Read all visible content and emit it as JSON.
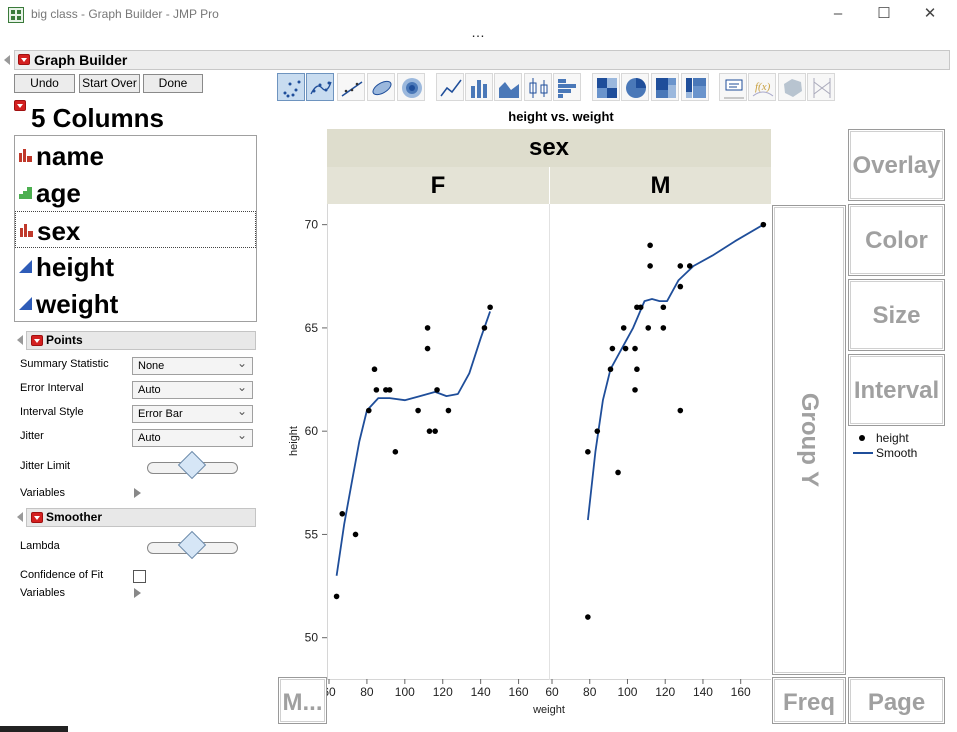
{
  "window": {
    "title": "big class - Graph Builder - JMP Pro",
    "min_glyph": "–",
    "max_glyph": "☐",
    "close_glyph": "✕",
    "overflow_glyph": "…"
  },
  "graph_builder": {
    "title": "Graph Builder",
    "buttons": {
      "undo": "Undo",
      "start_over": "Start Over",
      "done": "Done"
    }
  },
  "columns": {
    "count_label": "5 Columns",
    "items": [
      {
        "label": "name",
        "type": "nominal-character",
        "color": "#c0392b"
      },
      {
        "label": "age",
        "type": "ordinal",
        "color": "#4caf50"
      },
      {
        "label": "sex",
        "type": "nominal-character",
        "color": "#c0392b"
      },
      {
        "label": "height",
        "type": "continuous",
        "color": "#2e5cb8"
      },
      {
        "label": "weight",
        "type": "continuous",
        "color": "#2e5cb8"
      }
    ],
    "selected": "sex"
  },
  "points_panel": {
    "title": "Points",
    "summary_statistic": {
      "label": "Summary Statistic",
      "value": "None"
    },
    "error_interval": {
      "label": "Error Interval",
      "value": "Auto"
    },
    "interval_style": {
      "label": "Interval Style",
      "value": "Error Bar"
    },
    "jitter": {
      "label": "Jitter",
      "value": "Auto"
    },
    "jitter_limit": {
      "label": "Jitter Limit",
      "level": 0.5
    },
    "variables": {
      "label": "Variables"
    }
  },
  "smoother_panel": {
    "title": "Smoother",
    "lambda": {
      "label": "Lambda",
      "level": 0.5
    },
    "confidence_of_fit": {
      "label": "Confidence of Fit",
      "checked": false
    },
    "variables": {
      "label": "Variables"
    }
  },
  "toolbar": {
    "icons": [
      "points-icon",
      "jitter-points-icon",
      "line-of-fit-icon",
      "ellipse-icon",
      "contour-icon",
      "line-icon",
      "bar-icon",
      "area-icon",
      "box-plot-icon",
      "histogram-icon",
      "heatmap-icon",
      "pie-icon",
      "treemap-icon",
      "mosaic-icon",
      "caption-box-icon",
      "formula-icon",
      "map-shapes-icon",
      "parallel-axes-icon"
    ],
    "active": [
      "points-icon",
      "jitter-points-icon"
    ]
  },
  "drop_zones": {
    "overlay": "Overlay",
    "color": "Color",
    "size": "Size",
    "interval": "Interval",
    "group_y": "Group Y",
    "freq": "Freq",
    "page": "Page",
    "map": "M..."
  },
  "legend": {
    "points": "height",
    "line": "Smooth",
    "line_color": "#1f4e9a"
  },
  "chart_data": {
    "type": "scatter",
    "title": "height vs. weight",
    "group_title": "sex",
    "xlabel": "weight",
    "ylabel": "height",
    "xlim": [
      60,
      175
    ],
    "ylim": [
      48,
      71
    ],
    "x_ticks": [
      60,
      80,
      100,
      120,
      140,
      160
    ],
    "y_ticks": [
      50,
      55,
      60,
      65,
      70
    ],
    "panels": [
      {
        "name": "F",
        "points": [
          [
            64,
            52
          ],
          [
            67,
            56
          ],
          [
            74,
            55
          ],
          [
            81,
            61
          ],
          [
            84,
            63
          ],
          [
            85,
            62
          ],
          [
            90,
            62
          ],
          [
            92,
            62
          ],
          [
            95,
            59
          ],
          [
            107,
            61
          ],
          [
            112,
            65
          ],
          [
            112,
            64
          ],
          [
            113,
            60
          ],
          [
            116,
            60
          ],
          [
            117,
            62
          ],
          [
            123,
            61
          ],
          [
            142,
            65
          ],
          [
            145,
            66
          ]
        ],
        "smooth": [
          [
            64,
            53
          ],
          [
            68,
            55.5
          ],
          [
            72,
            57.5
          ],
          [
            76,
            59.5
          ],
          [
            80,
            61
          ],
          [
            86,
            61.6
          ],
          [
            92,
            61.6
          ],
          [
            100,
            61.5
          ],
          [
            108,
            61.7
          ],
          [
            116,
            61.9
          ],
          [
            122,
            61.7
          ],
          [
            128,
            61.8
          ],
          [
            134,
            62.8
          ],
          [
            140,
            64.5
          ],
          [
            145,
            65.8
          ]
        ]
      },
      {
        "name": "M",
        "points": [
          [
            79,
            51
          ],
          [
            79,
            59
          ],
          [
            84,
            60
          ],
          [
            91,
            63
          ],
          [
            95,
            58
          ],
          [
            92,
            64
          ],
          [
            98,
            65
          ],
          [
            99,
            64
          ],
          [
            104,
            64
          ],
          [
            104,
            62
          ],
          [
            105,
            63
          ],
          [
            105,
            66
          ],
          [
            107,
            66
          ],
          [
            111,
            65
          ],
          [
            112,
            69
          ],
          [
            112,
            68
          ],
          [
            119,
            65
          ],
          [
            119,
            66
          ],
          [
            128,
            68
          ],
          [
            128,
            67
          ],
          [
            128,
            61
          ],
          [
            133,
            68
          ],
          [
            172,
            70
          ]
        ]
      }
    ],
    "smooth_m": [
      [
        79,
        55.7
      ],
      [
        83,
        59
      ],
      [
        87,
        61.5
      ],
      [
        91,
        63
      ],
      [
        97,
        64
      ],
      [
        103,
        65
      ],
      [
        109,
        66.3
      ],
      [
        113,
        66.4
      ],
      [
        117,
        66.3
      ],
      [
        121,
        66.3
      ],
      [
        127,
        67.3
      ],
      [
        135,
        68
      ],
      [
        145,
        68.5
      ],
      [
        157,
        69.2
      ],
      [
        172,
        70
      ]
    ]
  }
}
